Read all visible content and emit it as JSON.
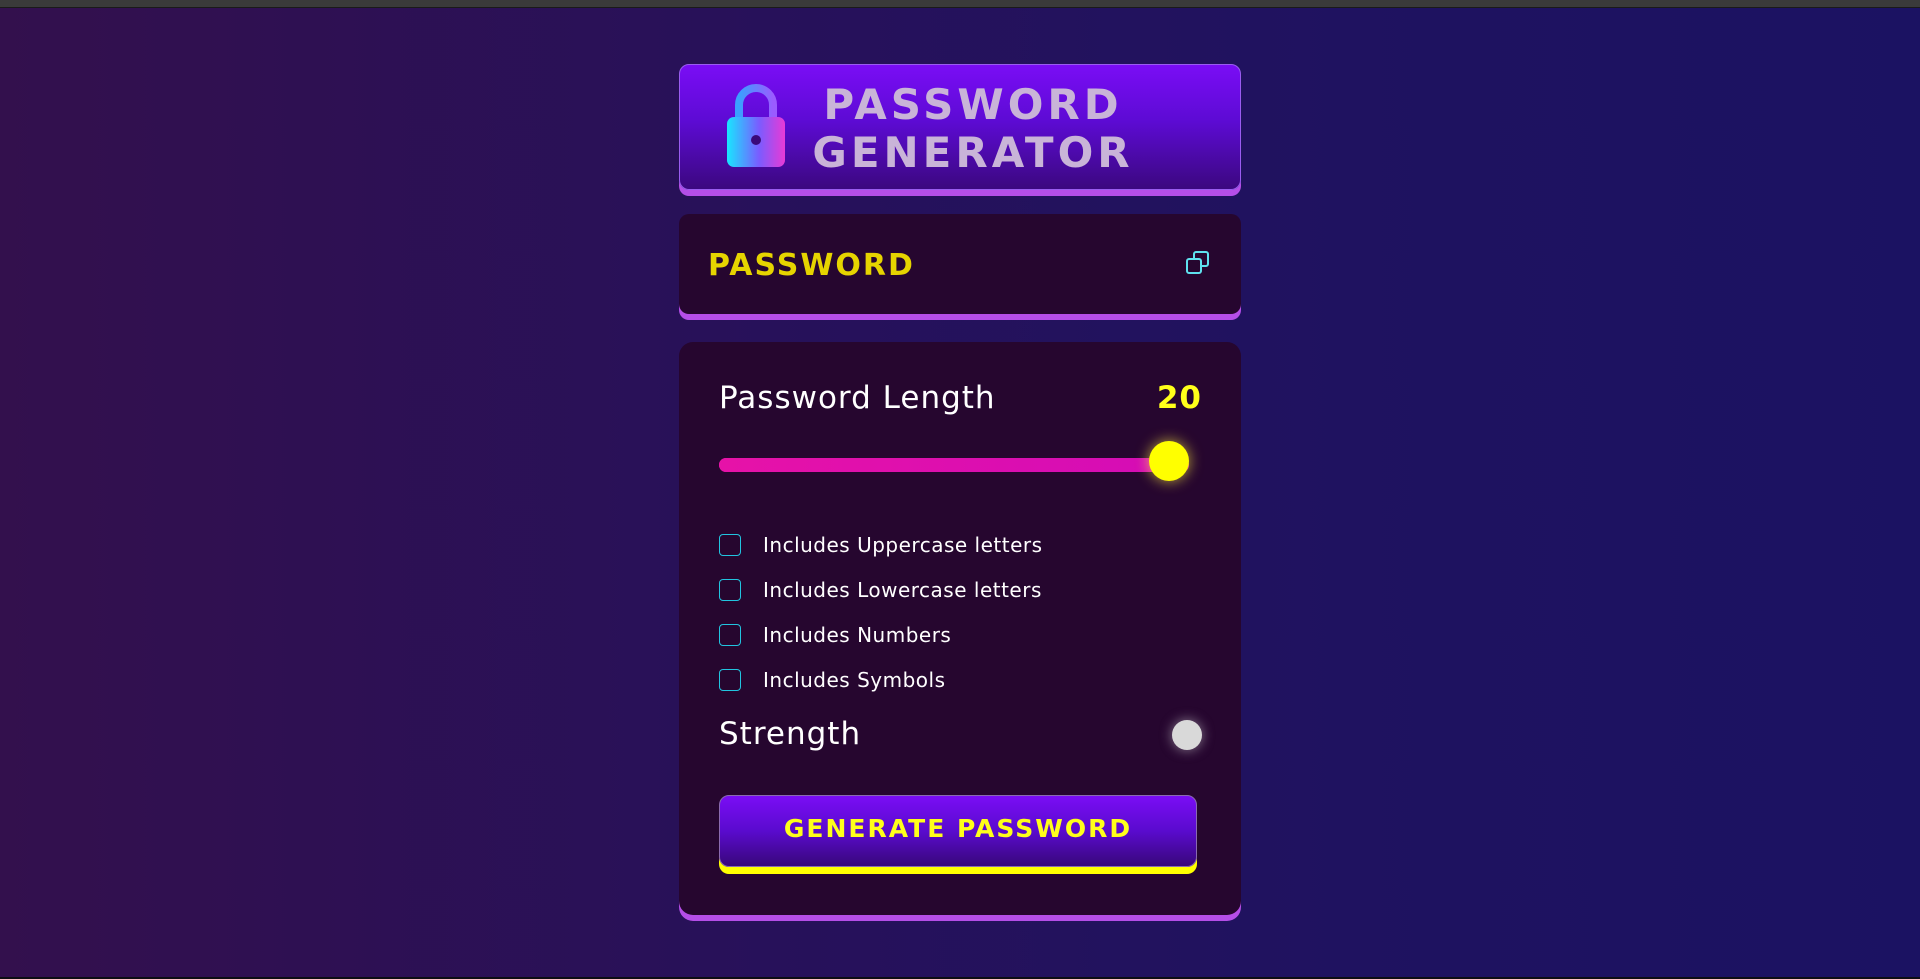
{
  "header": {
    "title_line1": "PASSWORD",
    "title_line2": "GENERATOR",
    "icon": "lock-icon"
  },
  "password_display": {
    "value": "PASSWORD",
    "copy_icon": "copy-icon"
  },
  "settings": {
    "length_label": "Password Length",
    "length_value": "20",
    "slider": {
      "value": 20,
      "fill_fraction": 1.0
    },
    "options": [
      {
        "label": "Includes Uppercase letters",
        "checked": false
      },
      {
        "label": "Includes Lowercase letters",
        "checked": false
      },
      {
        "label": "Includes Numbers",
        "checked": false
      },
      {
        "label": "Includes Symbols",
        "checked": false
      }
    ],
    "strength_label": "Strength",
    "generate_label": "GENERATE PASSWORD"
  },
  "colors": {
    "accent_yellow": "#ffff00",
    "accent_magenta": "#e612a8",
    "accent_cyan": "#22c4e0",
    "card_bg": "#26062f",
    "card_shadow": "#b54ee8",
    "button_gradient_top": "#7a0df5"
  }
}
